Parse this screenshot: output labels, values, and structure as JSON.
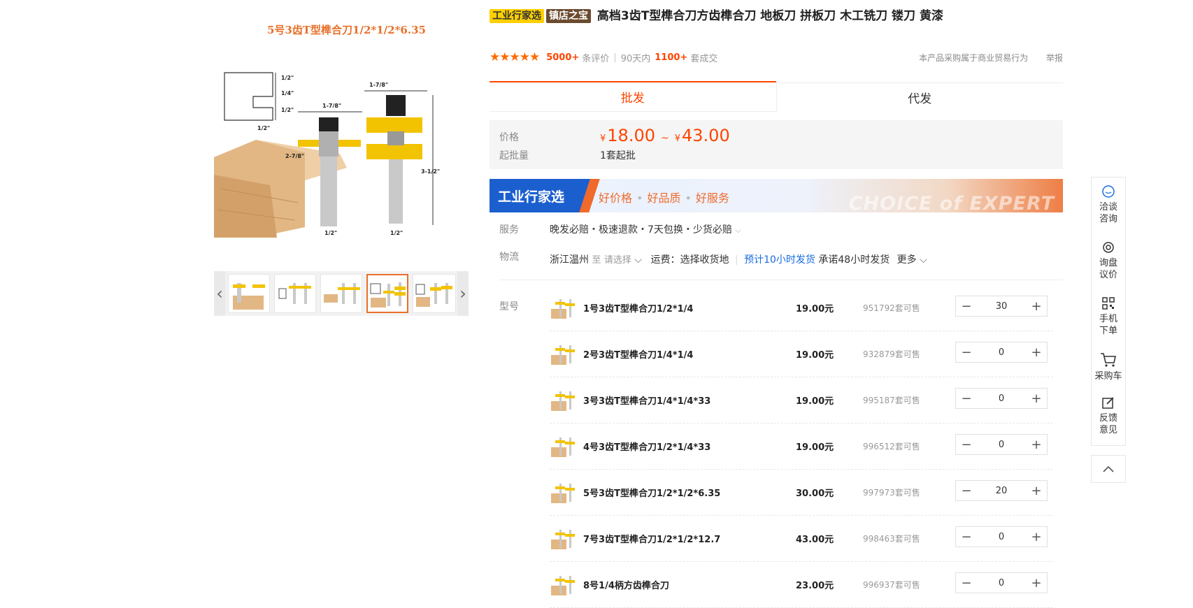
{
  "gallery": {
    "main_caption": "5号3齿T型榫合刀1/2*1/2*6.35",
    "dims": [
      "1/2\"",
      "1/4\"",
      "1/2\"",
      "1/2\"",
      "1-7/8\"",
      "1-7/8\"",
      "2-7/8\"",
      "3-1/2\"",
      "1/2\"",
      "1/2\""
    ],
    "prev_icon": "chevron-left-icon",
    "next_icon": "chevron-right-icon"
  },
  "product": {
    "tags": [
      "工业行家选",
      "镇店之宝"
    ],
    "title": "高档3齿T型榫合刀方齿榫合刀 地板刀 拼板刀 木工铣刀 镂刀 黄漆",
    "stars": "★★★★★",
    "review_count": "5000+",
    "review_label": "条评价",
    "period_label": "90天内",
    "sold_count": "1100+",
    "sold_label": "套成交",
    "notice": "本产品采购属于商业贸易行为",
    "report": "举报"
  },
  "tabs": [
    "批发",
    "代发"
  ],
  "price_box": {
    "price_label": "价格",
    "currency": "¥",
    "price_min": "18.00",
    "tilde": "~",
    "price_max": "43.00",
    "moq_label": "起批量",
    "moq_value": "1套起批"
  },
  "banner": {
    "logo": "工业行家选",
    "items": [
      "好价格",
      "好品质",
      "好服务"
    ],
    "en_text": "CHOICE of EXPERT"
  },
  "service": {
    "label": "服务",
    "text": "晚发必赔・极速退款・7天包换・少货必赔"
  },
  "logistics": {
    "label": "物流",
    "origin": "浙江温州",
    "to": "至",
    "select": "请选择",
    "freight": "运费：选择收货地",
    "eta": "预计10小时发货",
    "promise": "承诺48小时发货",
    "more": "更多"
  },
  "sku": {
    "label": "型号",
    "rows": [
      {
        "name": "1号3齿T型榫合刀1/2*1/4",
        "price": "19.00元",
        "stock": "951792套可售",
        "qty": "30"
      },
      {
        "name": "2号3齿T型榫合刀1/4*1/4",
        "price": "19.00元",
        "stock": "932879套可售",
        "qty": "0"
      },
      {
        "name": "3号3齿T型榫合刀1/4*1/4*33",
        "price": "19.00元",
        "stock": "995187套可售",
        "qty": "0"
      },
      {
        "name": "4号3齿T型榫合刀1/2*1/4*33",
        "price": "19.00元",
        "stock": "996512套可售",
        "qty": "0"
      },
      {
        "name": "5号3齿T型榫合刀1/2*1/2*6.35",
        "price": "30.00元",
        "stock": "997973套可售",
        "qty": "20"
      },
      {
        "name": "7号3齿T型榫合刀1/2*1/2*12.7",
        "price": "43.00元",
        "stock": "998463套可售",
        "qty": "0"
      },
      {
        "name": "8号1/4柄方齿榫合刀",
        "price": "23.00元",
        "stock": "996937套可售",
        "qty": "0"
      }
    ],
    "minus": "−",
    "plus": "+"
  },
  "toolbar": {
    "items": [
      {
        "label1": "洽谈",
        "label2": "咨询",
        "icon": "chat-icon"
      },
      {
        "label1": "询盘",
        "label2": "议价",
        "icon": "inquiry-icon"
      },
      {
        "label1": "手机",
        "label2": "下单",
        "icon": "qrcode-icon"
      },
      {
        "label1": "采购车",
        "label2": "",
        "icon": "cart-icon"
      },
      {
        "label1": "反馈",
        "label2": "意见",
        "icon": "feedback-icon"
      }
    ],
    "top_icon": "chevron-up-icon",
    "accent": "#1a6ce0"
  },
  "colors": {
    "accent": "#ff4400",
    "orange": "#e8702a",
    "brand_blue": "#1b5fcf",
    "tag_yellow": "#ffd000"
  }
}
